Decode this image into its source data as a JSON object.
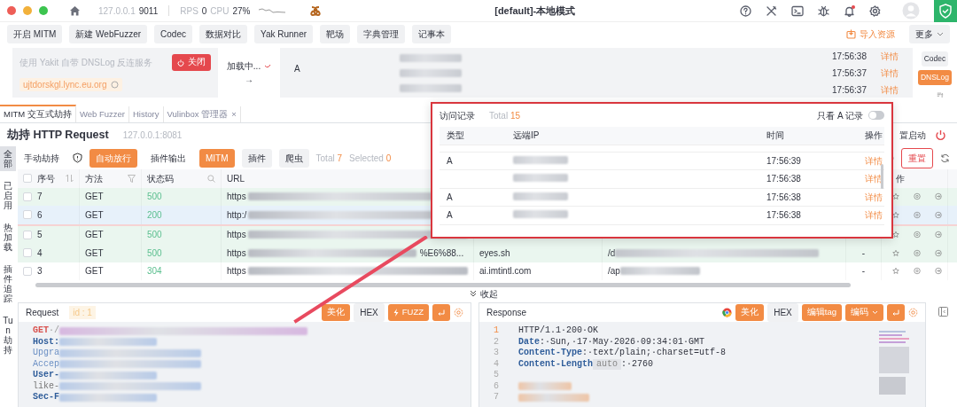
{
  "titlebar": {
    "host": "127.0.0.1",
    "port": "9011",
    "rps_label": "RPS",
    "rps": "0",
    "cpu_label": "CPU",
    "cpu": "27%",
    "title": "[default]-本地模式",
    "notification_dot": true
  },
  "toolbar": {
    "buttons": [
      "开启 MITM",
      "新建 WebFuzzer",
      "Codec",
      "数据对比",
      "Yak Runner",
      "靶场",
      "字典管理",
      "记事本"
    ],
    "import": "导入资源",
    "more": "更多"
  },
  "dnslog": {
    "notice": "使用 Yakit 自带 DNSLog 反连服务",
    "close": "关闭",
    "domain": "ujtdorskgl.lync.eu.org",
    "loading": "加载中...",
    "arrow": "→",
    "type": "A",
    "records": [
      {
        "time": "17:56:38",
        "action": "详情"
      },
      {
        "time": "17:56:37",
        "action": "详情"
      },
      {
        "time": "17:56:37",
        "action": "详情"
      }
    ],
    "side_tabs": [
      {
        "label": "Codec",
        "selected": false
      },
      {
        "label": "DNSLog",
        "selected": true
      }
    ]
  },
  "tabs": [
    {
      "label": "MITM 交互式劫持",
      "selected": true
    },
    {
      "label": "Web Fuzzer",
      "selected": false
    },
    {
      "label": "History",
      "selected": false
    },
    {
      "label": "Vulinbox 管理器",
      "selected": false,
      "close": "×"
    }
  ],
  "hijack": {
    "title": "劫持 HTTP Request",
    "address": "127.0.0.1:8081",
    "config": "置启动"
  },
  "side_nav": [
    {
      "label": "全部",
      "selected": true
    },
    {
      "label": "已启用",
      "selected": false
    },
    {
      "label": "热加载",
      "selected": false
    },
    {
      "label": "插件追踪",
      "selected": false
    },
    {
      "label": "Tun劫持",
      "selected": false
    }
  ],
  "filters": {
    "modes": [
      {
        "label": "手动劫持",
        "selected": false
      },
      {
        "label": "自动放行",
        "selected": true
      },
      {
        "label": "插件输出",
        "selected": false
      }
    ],
    "tags": [
      {
        "label": "MITM",
        "selected": true
      },
      {
        "label": "插件",
        "selected": false
      },
      {
        "label": "爬虫",
        "selected": false
      }
    ],
    "total_label": "Total",
    "total": "7",
    "selected_label": "Selected",
    "selected": "0",
    "reset": "重置"
  },
  "table": {
    "columns": [
      "序号",
      "方法",
      "状态码",
      "URL"
    ],
    "action_column": "作",
    "all_checked": false,
    "rows": [
      {
        "id": "7",
        "method": "GET",
        "status": "500",
        "url": "https",
        "color": "#eaf6ef",
        "flagged": false
      },
      {
        "id": "6",
        "method": "GET",
        "status": "200",
        "url": "http:/",
        "color": "#e7f1fa",
        "flagged": true
      },
      {
        "id": "5",
        "method": "GET",
        "status": "500",
        "url": "https",
        "color": "#eaf6ef",
        "flagged": false
      },
      {
        "id": "4",
        "method": "GET",
        "status": "500",
        "url": "https",
        "url_tail": "%E6%88...",
        "host": "eyes.sh",
        "path": "/d",
        "extra": "-",
        "color": "#eaf6ef",
        "flagged": false
      },
      {
        "id": "3",
        "method": "GET",
        "status": "304",
        "url": "https",
        "host": "ai.imtintl.com",
        "path": "/ap",
        "extra": "-",
        "color": "#ffffff",
        "flagged": false
      }
    ]
  },
  "collapse": "收起",
  "request": {
    "title": "Request",
    "id": "id : 1",
    "beautify": "美化",
    "hex": "HEX",
    "fuzz": "FUZZ",
    "lines": [
      {
        "kind": "method",
        "text": "GET",
        "rest": "·/"
      },
      {
        "kind": "header",
        "text": "Host:"
      },
      {
        "kind": "light",
        "text": "Upgra"
      },
      {
        "kind": "light",
        "text": "Accep"
      },
      {
        "kind": "header",
        "text": "User-"
      },
      {
        "kind": "plain",
        "text": "like-"
      },
      {
        "kind": "header",
        "text": "Sec-F"
      }
    ]
  },
  "response": {
    "title": "Response",
    "beautify": "美化",
    "hex": "HEX",
    "edit_tag": "编辑tag",
    "encode": "编码",
    "lines": [
      {
        "no": "1",
        "kind": "status",
        "text": "HTTP/1.1·200·OK"
      },
      {
        "no": "2",
        "kind": "header",
        "name": "Date",
        "text": ":·Sun,·17·May·2026·09:34:01·GMT"
      },
      {
        "no": "3",
        "kind": "header",
        "name": "Content-Type",
        "text": ":·text/plain;·charset=utf-8"
      },
      {
        "no": "4",
        "kind": "header",
        "name": "Content-Length",
        "chip": "auto",
        "text": ":·2760"
      },
      {
        "no": "5",
        "kind": "empty"
      },
      {
        "no": "6",
        "kind": "blurred"
      },
      {
        "no": "7",
        "kind": "blurred"
      }
    ]
  },
  "popup": {
    "title": "访问记录",
    "total_label": "Total",
    "total": "15",
    "filter_label": "只看 A 记录",
    "filter_on": false,
    "columns": [
      "类型",
      "远端IP",
      "时间",
      "操作"
    ],
    "rows": [
      {
        "type": "A",
        "time": "17:56:39",
        "action": "详情"
      },
      {
        "time": "17:56:38",
        "action": "详情"
      },
      {
        "type": "A",
        "time": "17:56:38",
        "action": "详情"
      },
      {
        "type": "A",
        "time": "17:56:38",
        "action": "详情"
      }
    ]
  }
}
